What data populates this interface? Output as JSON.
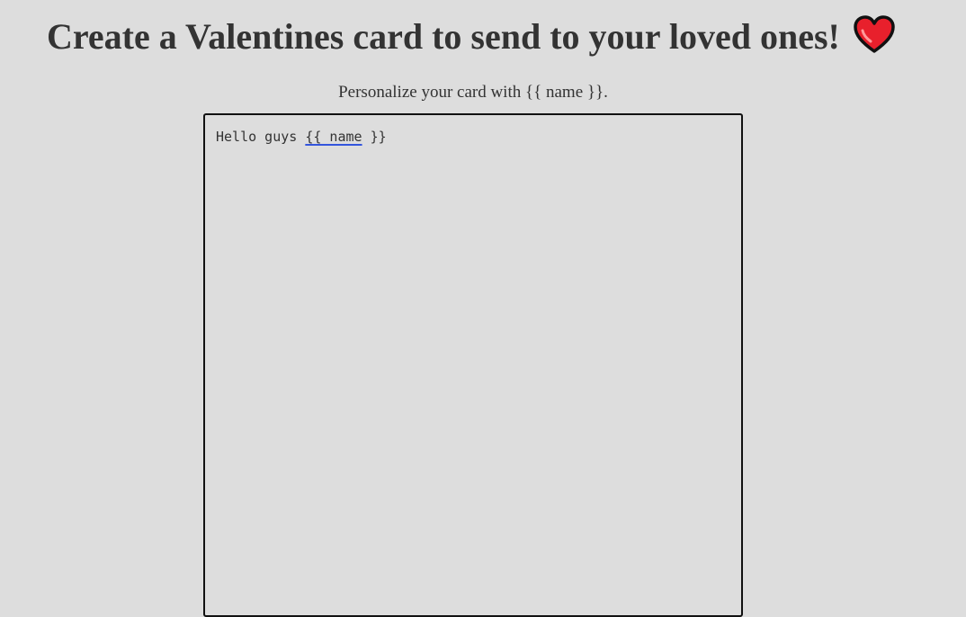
{
  "header": {
    "title": "Create a Valentines card to send to your loved ones!",
    "heart_icon": "red-heart-icon",
    "heart_color": "#e8202c"
  },
  "subtitle": "Personalize your card with {{ name }}.",
  "editor": {
    "text_before": "Hello guys ",
    "token": "{{ name",
    "text_after": " }}",
    "border_color": "#111111",
    "token_underline_color": "#3355dd"
  }
}
